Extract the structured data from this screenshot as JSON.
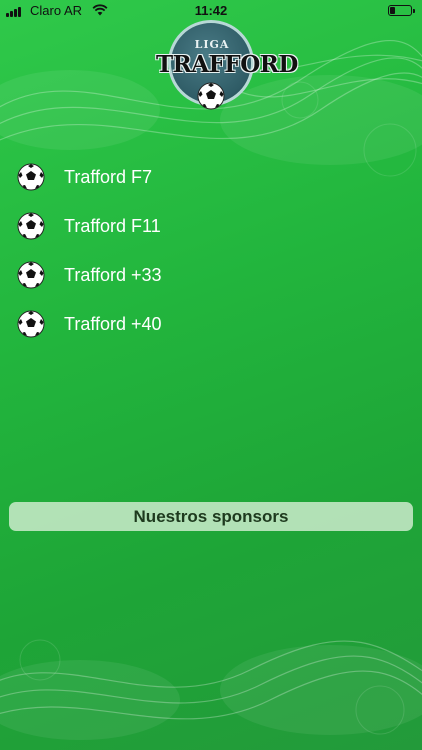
{
  "status_bar": {
    "carrier": "Claro AR",
    "time": "11:42",
    "signal_icon": "signal-bars-icon",
    "wifi_icon": "wifi-icon",
    "battery_icon": "battery-icon",
    "battery_level": 0.25
  },
  "logo": {
    "line1": "LIGA",
    "line2": "TRAFFORD"
  },
  "menu": {
    "items": [
      {
        "label": "Trafford F7",
        "icon": "soccer-ball-icon"
      },
      {
        "label": "Trafford F11",
        "icon": "soccer-ball-icon"
      },
      {
        "label": "Trafford +33",
        "icon": "soccer-ball-icon"
      },
      {
        "label": "Trafford +40",
        "icon": "soccer-ball-icon"
      }
    ]
  },
  "sponsors_button": {
    "label": "Nuestros sponsors"
  },
  "colors": {
    "background": "#22b53d",
    "menu_text": "#ffffff",
    "button_bg": "#cdebcd",
    "button_text": "#1e3a1e"
  }
}
